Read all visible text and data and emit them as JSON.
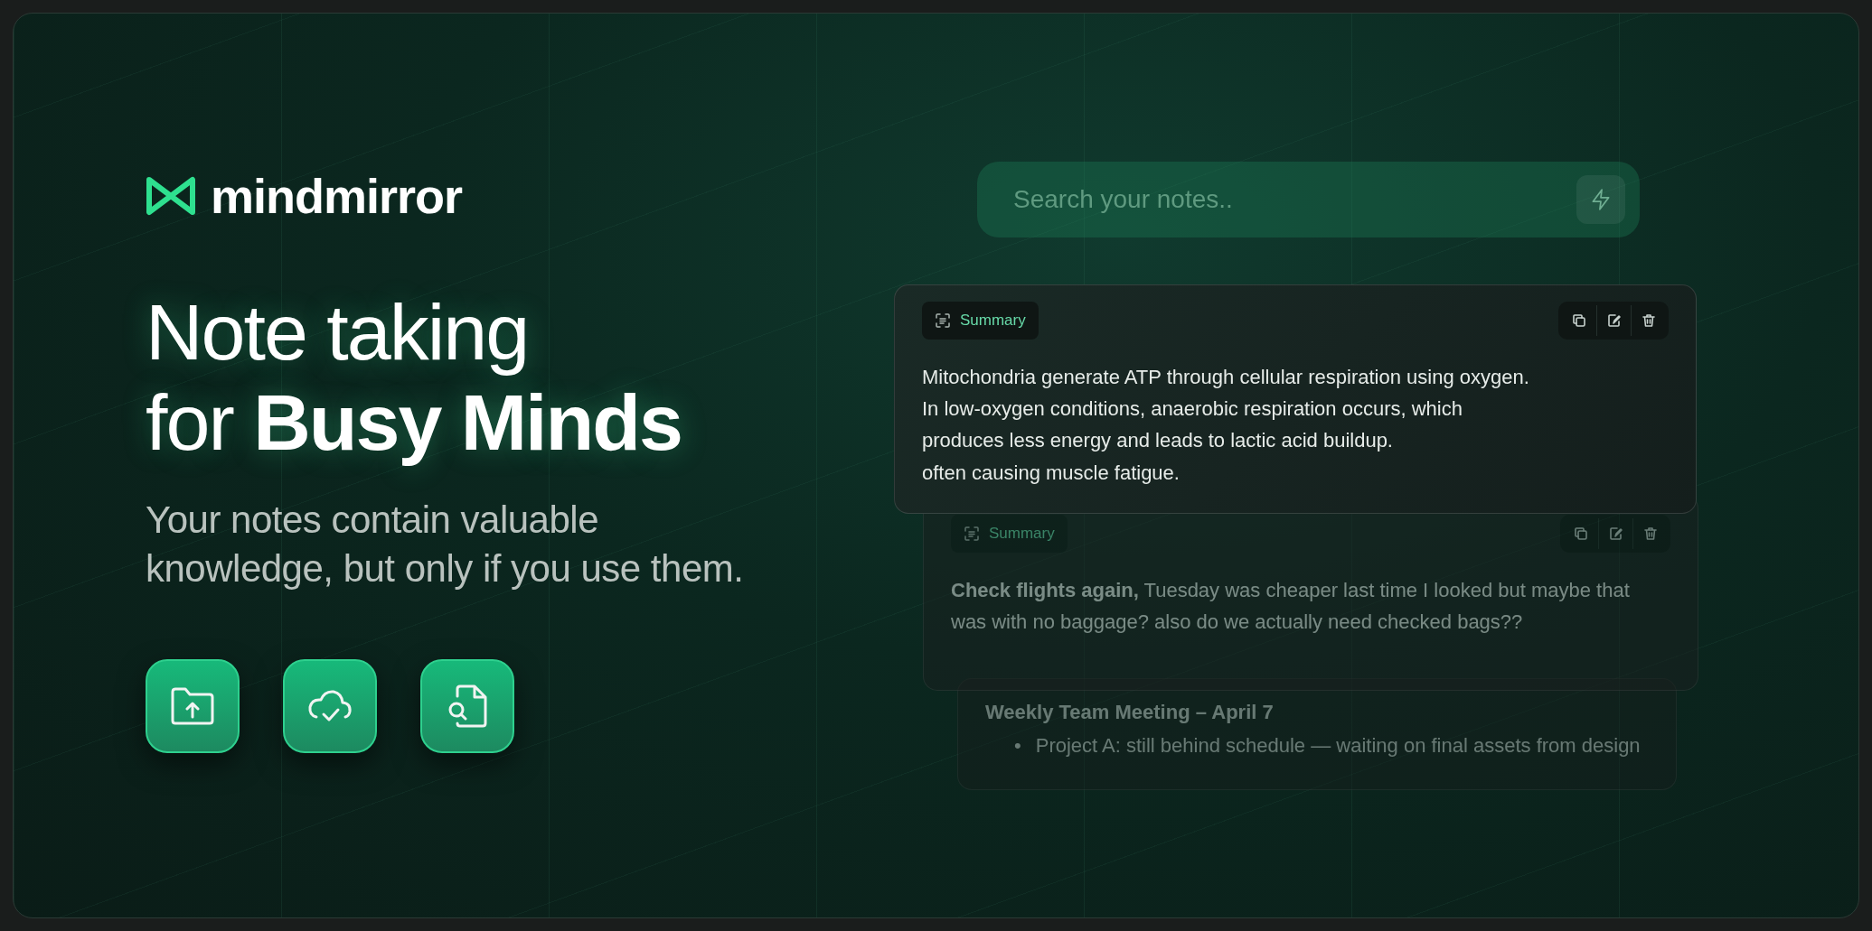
{
  "brand": {
    "name": "mindmirror"
  },
  "headline": [
    "Note taking",
    "for **Busy Minds**"
  ],
  "subtitle": [
    "Your notes contain valuable",
    "knowledge, but only if you use them."
  ],
  "actions": [
    {
      "kind": "upload"
    },
    {
      "kind": "cloud"
    },
    {
      "kind": "file-search"
    }
  ],
  "search": {
    "placeholder": "Search your notes.."
  },
  "notes": [
    {
      "kind": "summary",
      "tag": "Summary",
      "lines": [
        "Mitochondria generate ATP through cellular respiration using oxygen.",
        "In low-oxygen conditions, anaerobic respiration occurs, which",
        "produces less energy and leads to lactic acid buildup.",
        "often causing muscle fatigue."
      ]
    },
    {
      "kind": "summary",
      "tag": "Summary",
      "lines": [
        "**Check flights again,** Tuesday was cheaper last time I looked but maybe that was with no baggage? also do we actually need checked bags??"
      ]
    },
    {
      "kind": "meeting",
      "title": "Weekly Team Meeting – April 7",
      "bullets": [
        {
          "marker": "•",
          "text": "Project A: still behind schedule — waiting on final assets from design"
        }
      ]
    }
  ]
}
